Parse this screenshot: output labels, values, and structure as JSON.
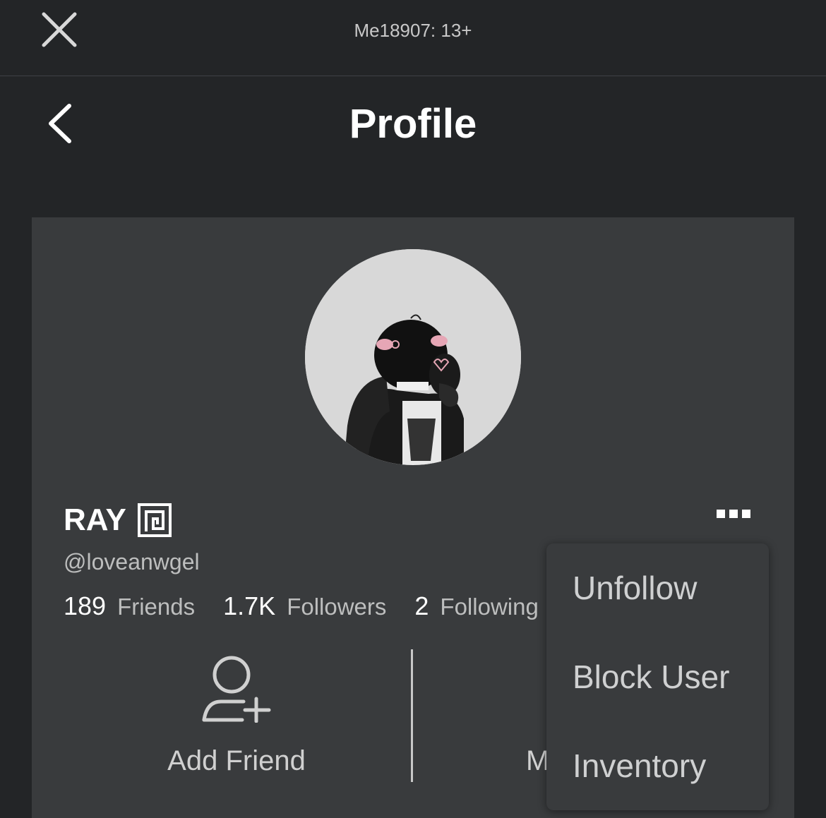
{
  "topbar": {
    "title": "Me18907: 13+",
    "close_icon": "close-icon"
  },
  "header": {
    "title": "Profile",
    "back_icon": "chevron-left-icon"
  },
  "profile": {
    "display_name": "RAY",
    "premium_icon": "premium-icon",
    "username": "@loveanwgel",
    "stats": [
      {
        "value": "189",
        "label": "Friends"
      },
      {
        "value": "1.7K",
        "label": "Followers"
      },
      {
        "value": "2",
        "label": "Following"
      }
    ],
    "more_icon": "more-options-icon"
  },
  "actions": {
    "add_friend_label": "Add Friend",
    "add_friend_icon": "add-friend-icon",
    "message_label": "Message"
  },
  "dropdown": {
    "items": [
      {
        "label": "Unfollow"
      },
      {
        "label": "Block User"
      },
      {
        "label": "Inventory"
      }
    ]
  },
  "colors": {
    "background": "#232527",
    "card": "#393b3d",
    "text_primary": "#ffffff",
    "text_secondary": "#bdbebe"
  }
}
